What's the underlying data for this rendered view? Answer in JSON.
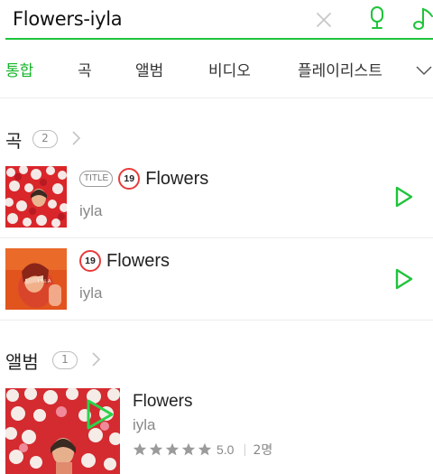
{
  "search": {
    "query": "Flowers-iyla"
  },
  "icons": {
    "clear": "close-icon",
    "voice": "microphone-icon",
    "music_recognition": "music-note-icon",
    "more_tabs": "chevron-down-icon",
    "play": "play-icon",
    "section_more": "chevron-right-icon",
    "star": "star-icon"
  },
  "colors": {
    "accent": "#1ec43a",
    "age_badge": "#e83b3b"
  },
  "tabs": [
    {
      "label": "통합",
      "active": true
    },
    {
      "label": "곡",
      "active": false
    },
    {
      "label": "앨범",
      "active": false
    },
    {
      "label": "비디오",
      "active": false
    },
    {
      "label": "플레이리스트",
      "active": false
    }
  ],
  "songs_section": {
    "title": "곡",
    "count": "2",
    "items": [
      {
        "title_badge": "TITLE",
        "age_badge": "19",
        "title": "Flowers",
        "artist": "iyla"
      },
      {
        "age_badge": "19",
        "title": "Flowers",
        "artist": "iyla"
      }
    ]
  },
  "albums_section": {
    "title": "앨범",
    "count": "1",
    "items": [
      {
        "title": "Flowers",
        "artist": "iyla",
        "rating": "5.0",
        "stars": 5,
        "rating_count": "2명"
      }
    ]
  }
}
